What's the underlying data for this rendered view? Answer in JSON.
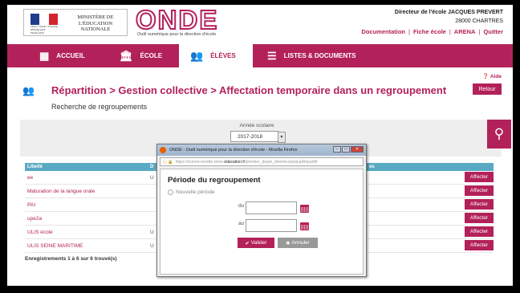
{
  "header": {
    "ministere": "MINISTÈRE DE L'ÉDUCATION NATIONALE",
    "republique": "Liberté • Égalité • Fraternité RÉPUBLIQUE FRANÇAISE",
    "app_title": "ONDE",
    "app_subtitle": "Outil numérique pour la direction d'école",
    "director": "Directeur de l'école JACQUES PREVERT",
    "city": "28000 CHARTRES",
    "links": [
      "Documentation",
      "Fiche école",
      "ARENA",
      "Quitter"
    ]
  },
  "nav": {
    "items": [
      {
        "label": "ACCUEIL",
        "icon": "grid-icon"
      },
      {
        "label": "ÉCOLE",
        "icon": "building-icon"
      },
      {
        "label": "ÉLÈVES",
        "icon": "students-icon"
      },
      {
        "label": "LISTES & DOCUMENTS",
        "icon": "list-icon"
      }
    ],
    "active": "ÉLÈVES"
  },
  "page": {
    "aide": "Aide",
    "title": "Répartition > Gestion collective > Affectation temporaire dans un regroupement",
    "retour": "Retour",
    "subtitle": "Recherche de regroupements"
  },
  "search": {
    "annee_label": "Année scolaire",
    "annee_value": "2017-2018"
  },
  "table": {
    "headers": [
      "Libellé",
      "D",
      "es"
    ],
    "rows": [
      {
        "libelle": "ee",
        "col2": "U",
        "action": "Affecter"
      },
      {
        "libelle": "Maturation de la langue orale",
        "col2": "",
        "action": "Affecter"
      },
      {
        "libelle": "PAI",
        "col2": "",
        "action": "Affecter"
      },
      {
        "libelle": "upe2a",
        "col2": "",
        "action": "Affecter"
      },
      {
        "libelle": "ULIS école",
        "col2": "U",
        "action": "Affecter"
      },
      {
        "libelle": "ULIS SEINE MARITIME",
        "col2": "U",
        "action": "Affecter"
      }
    ],
    "footer": "Enregistrements 1 à 6 sur 6 trouvé(s)"
  },
  "popup": {
    "window_title": "ONDE - Outil numérique pour la direction d'école - Mozilla Firefox",
    "url_prefix": "https://sconet-recette.orion.",
    "url_domain": "education.fr",
    "url_suffix": "/premier_degre_directeur/popupRepartiti",
    "heading": "Période du regroupement",
    "nouvelle_periode": "Nouvelle période",
    "du_label": "du",
    "au_label": "au",
    "valider": "Valider",
    "annuler": "Annuler"
  },
  "colors": {
    "brand": "#b3215a",
    "table_header": "#5aa9c2"
  }
}
